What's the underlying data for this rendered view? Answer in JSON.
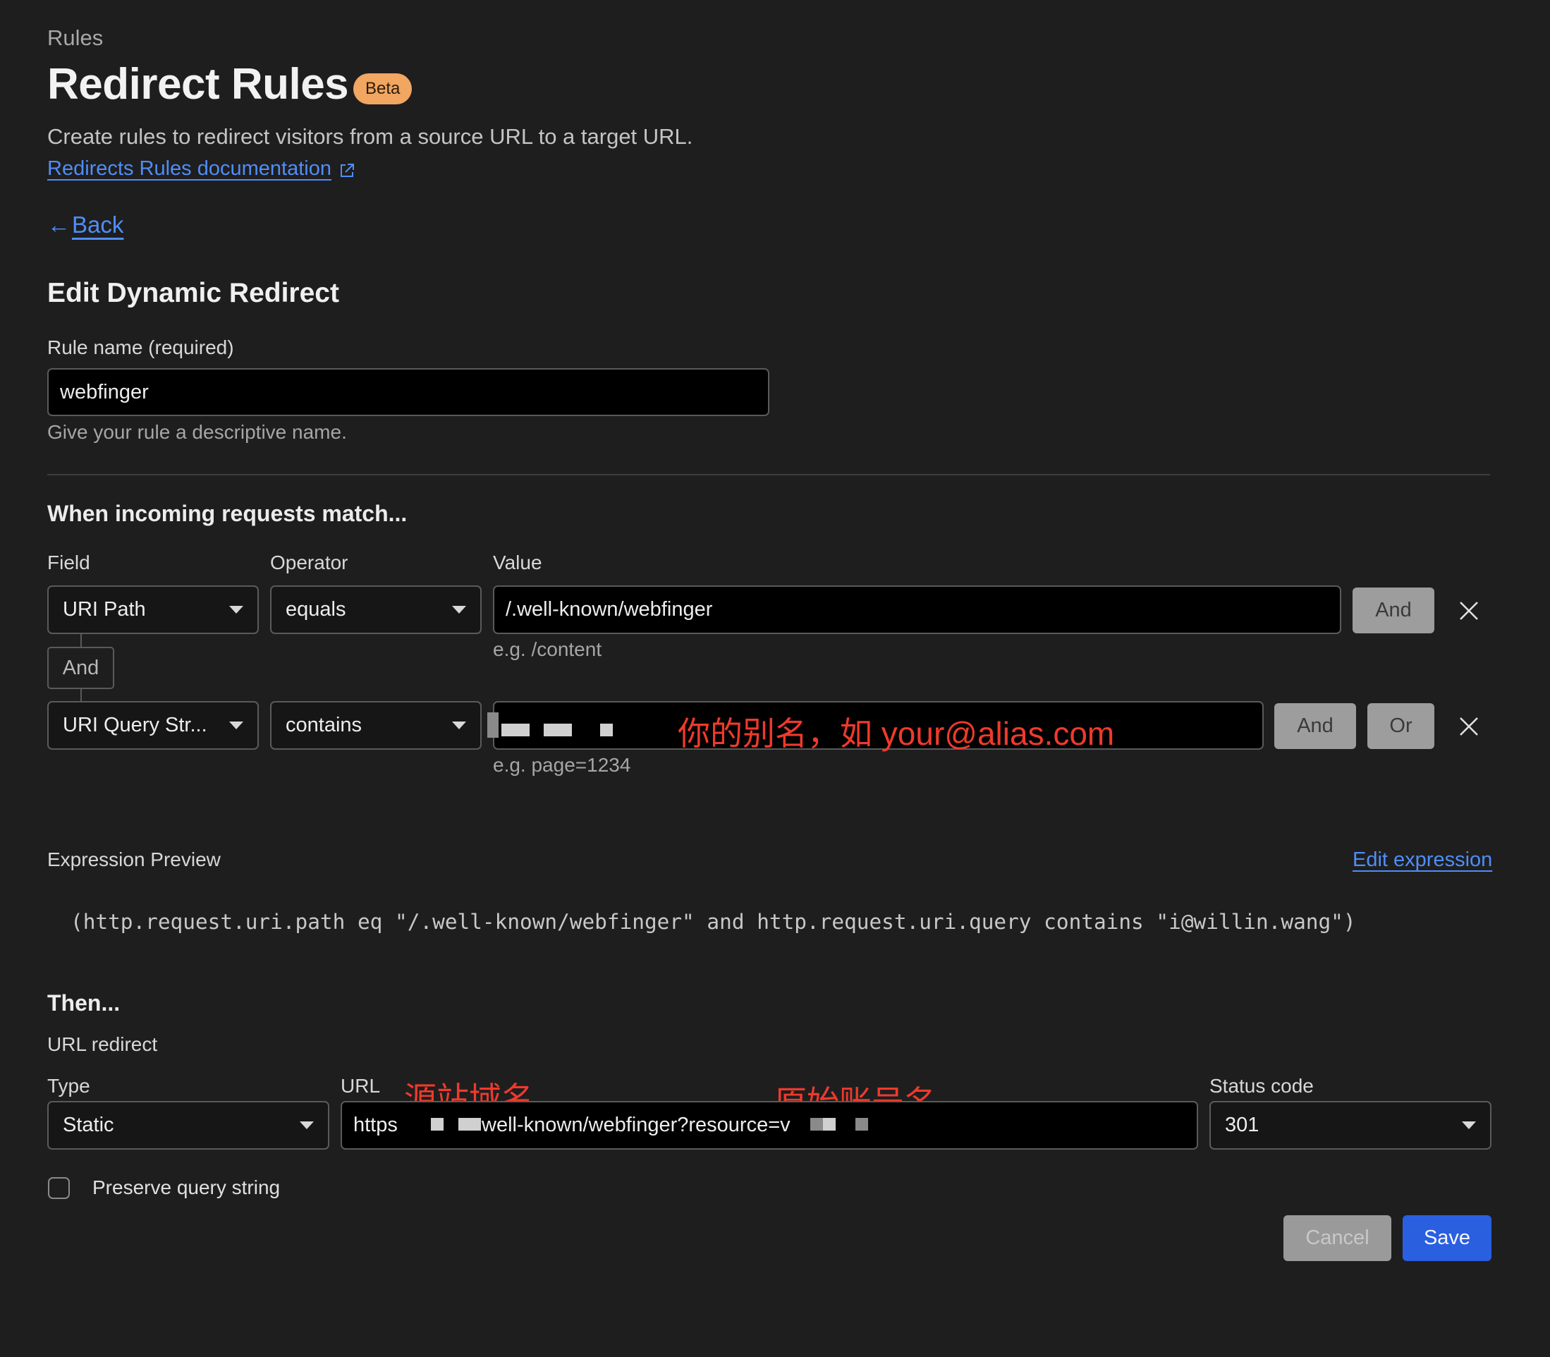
{
  "header": {
    "breadcrumb": "Rules",
    "title": "Redirect Rules",
    "badge": "Beta",
    "description": "Create rules to redirect visitors from a source URL to a target URL.",
    "doc_link": "Redirects Rules documentation",
    "back_arrow": "←",
    "back_label": "Back"
  },
  "form": {
    "section_title": "Edit Dynamic Redirect",
    "rule_name_label": "Rule name (required)",
    "rule_name_value": "webfinger",
    "rule_name_hint": "Give your rule a descriptive name."
  },
  "match": {
    "title": "When incoming requests match...",
    "col_field": "Field",
    "col_operator": "Operator",
    "col_value": "Value",
    "rows": [
      {
        "field": "URI Path",
        "operator": "equals",
        "value": "/.well-known/webfinger",
        "hint": "e.g. /content",
        "and_label": "And"
      },
      {
        "field": "URI Query Str...",
        "operator": "contains",
        "value": "",
        "hint": "e.g. page=1234",
        "and_label": "And",
        "or_label": "Or"
      }
    ],
    "connector_label": "And",
    "annotation": "你的别名，如 your@alias.com"
  },
  "expression": {
    "label": "Expression Preview",
    "edit_link": "Edit expression",
    "text": "(http.request.uri.path eq \"/.well-known/webfinger\" and http.request.uri.query contains \"i@willin.wang\")"
  },
  "then": {
    "title": "Then...",
    "subtitle": "URL redirect",
    "type_label": "Type",
    "type_value": "Static",
    "url_label": "URL",
    "url_prefix": "https",
    "url_mid": "well-known/webfinger?resource=v",
    "annotation_domain": "源站域名",
    "annotation_account": "原始账号名",
    "status_label": "Status code",
    "status_value": "301",
    "preserve_label": "Preserve query string",
    "preserve_checked": false
  },
  "actions": {
    "cancel": "Cancel",
    "save": "Save"
  },
  "colors": {
    "background": "#1e1e1f",
    "link": "#4f8ef7",
    "badge": "#f1a661",
    "primary": "#2a5fe0",
    "annotation": "#ee3a2c"
  }
}
